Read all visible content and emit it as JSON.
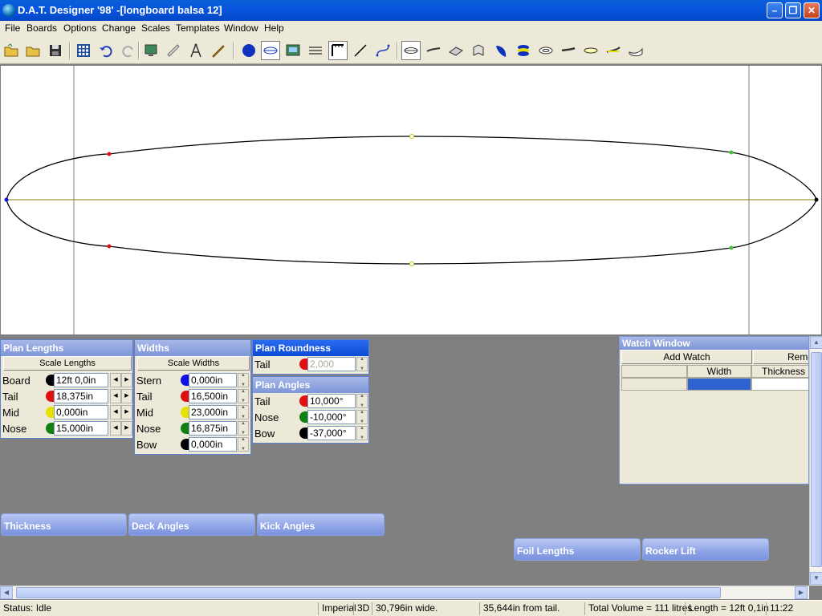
{
  "window": {
    "title": "D.A.T. Designer '98' -[longboard balsa 12]"
  },
  "menu": [
    "File",
    "Boards",
    "Options",
    "Change",
    "Scales",
    "Templates",
    "Window",
    "Help"
  ],
  "plan_lengths": {
    "title": "Plan Lengths",
    "scale_button": "Scale Lengths",
    "rows": [
      {
        "label": "Board",
        "value": "12ft 0,0in",
        "color": "#000000"
      },
      {
        "label": "Tail",
        "value": "18,375in",
        "color": "#e01010"
      },
      {
        "label": "Mid",
        "value": "0,000in",
        "color": "#e8e000"
      },
      {
        "label": "Nose",
        "value": "15,000in",
        "color": "#108010"
      }
    ]
  },
  "widths": {
    "title": "Widths",
    "scale_button": "Scale Widths",
    "rows": [
      {
        "label": "Stern",
        "value": "0,000in",
        "color": "#1010e0"
      },
      {
        "label": "Tail",
        "value": "16,500in",
        "color": "#e01010"
      },
      {
        "label": "Mid",
        "value": "23,000in",
        "color": "#e8e000"
      },
      {
        "label": "Nose",
        "value": "16,875in",
        "color": "#108010"
      },
      {
        "label": "Bow",
        "value": "0,000in",
        "color": "#000000"
      }
    ]
  },
  "plan_roundness": {
    "title": "Plan Roundness",
    "rows": [
      {
        "label": "Tail",
        "value": "2,000",
        "color": "#e01010"
      }
    ]
  },
  "plan_angles": {
    "title": "Plan Angles",
    "rows": [
      {
        "label": "Tail",
        "value": "10,000°",
        "color": "#e01010"
      },
      {
        "label": "Nose",
        "value": "-10,000°",
        "color": "#108010"
      },
      {
        "label": "Bow",
        "value": "-37,000°",
        "color": "#000000"
      }
    ]
  },
  "collapsed_panels": {
    "thickness": "Thickness",
    "deck_angles": "Deck Angles",
    "kick_angles": "Kick Angles",
    "foil_lengths": "Foil Lengths",
    "rocker_lift": "Rocker Lift"
  },
  "watch": {
    "title": "Watch Window",
    "add_watch": "Add Watch",
    "remove": "Remo",
    "col_width": "Width",
    "col_thickness": "Thickness"
  },
  "status": {
    "state": "Status: Idle",
    "units": "Imperial",
    "mode": "3D",
    "width_info": "30,796in wide.",
    "position_info": "35,644in from tail.",
    "volume": "Total Volume = 111 litres",
    "length": "Length = 12ft 0,1in",
    "time": "11:22"
  },
  "colors": {
    "accent": "#0a5fd8",
    "outline": "#000000",
    "centerline": "#808000"
  }
}
